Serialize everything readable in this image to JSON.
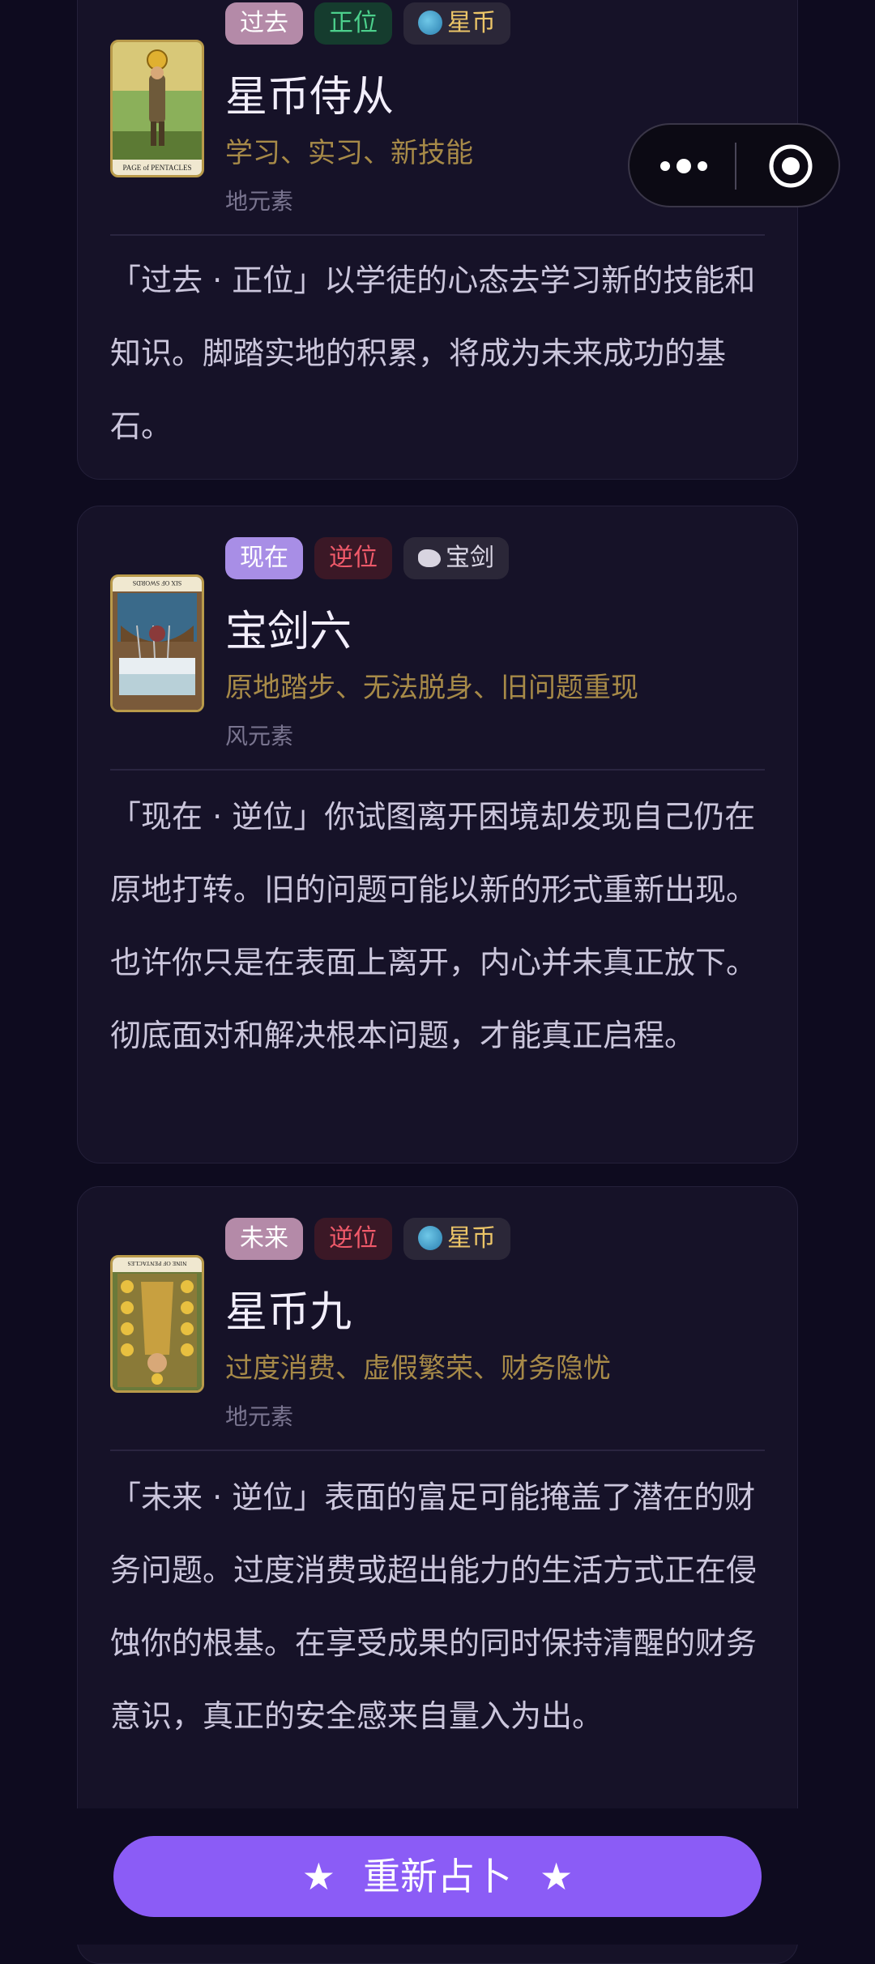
{
  "readings": [
    {
      "period": "过去",
      "orientation": "正位",
      "suit": "星币",
      "name": "星币侍从",
      "keywords": "学习、实习、新技能",
      "element": "地元素",
      "description": "「过去 · 正位」以学徒的心态去学习新的技能和知识。脚踏实地的积累，将成为未来成功的基石。",
      "card_caption": "PAGE of PENTACLES"
    },
    {
      "period": "现在",
      "orientation": "逆位",
      "suit": "宝剑",
      "name": "宝剑六",
      "keywords": "原地踏步、无法脱身、旧问题重现",
      "element": "风元素",
      "description": "「现在 · 逆位」你试图离开困境却发现自己仍在原地打转。旧的问题可能以新的形式重新出现。也许你只是在表面上离开，内心并未真正放下。彻底面对和解决根本问题，才能真正启程。",
      "card_caption": "SIX OF SWORDS"
    },
    {
      "period": "未来",
      "orientation": "逆位",
      "suit": "星币",
      "name": "星币九",
      "keywords": "过度消费、虚假繁荣、财务隐忧",
      "element": "地元素",
      "description": "「未来 · 逆位」表面的富足可能掩盖了潜在的财务问题。过度消费或超出能力的生活方式正在侵蚀你的根基。在享受成果的同时保持清醒的财务意识，真正的安全感来自量入为出。",
      "card_caption": "NINE OF PENTACLES"
    }
  ],
  "redo_button": {
    "star_left": "★",
    "label": "重新占卜",
    "star_right": "★"
  },
  "icons": {
    "pentacle_suit": "globe-icon",
    "sword_suit": "cloud-icon",
    "menu": "more-dots-icon",
    "close": "target-close-icon"
  },
  "colors": {
    "background": "#0e0b1f",
    "card": "#161228",
    "accent": "#8b5cf6",
    "keyword": "#a78a48",
    "upright": "#4cd08c",
    "reversed": "#f05a6a"
  }
}
